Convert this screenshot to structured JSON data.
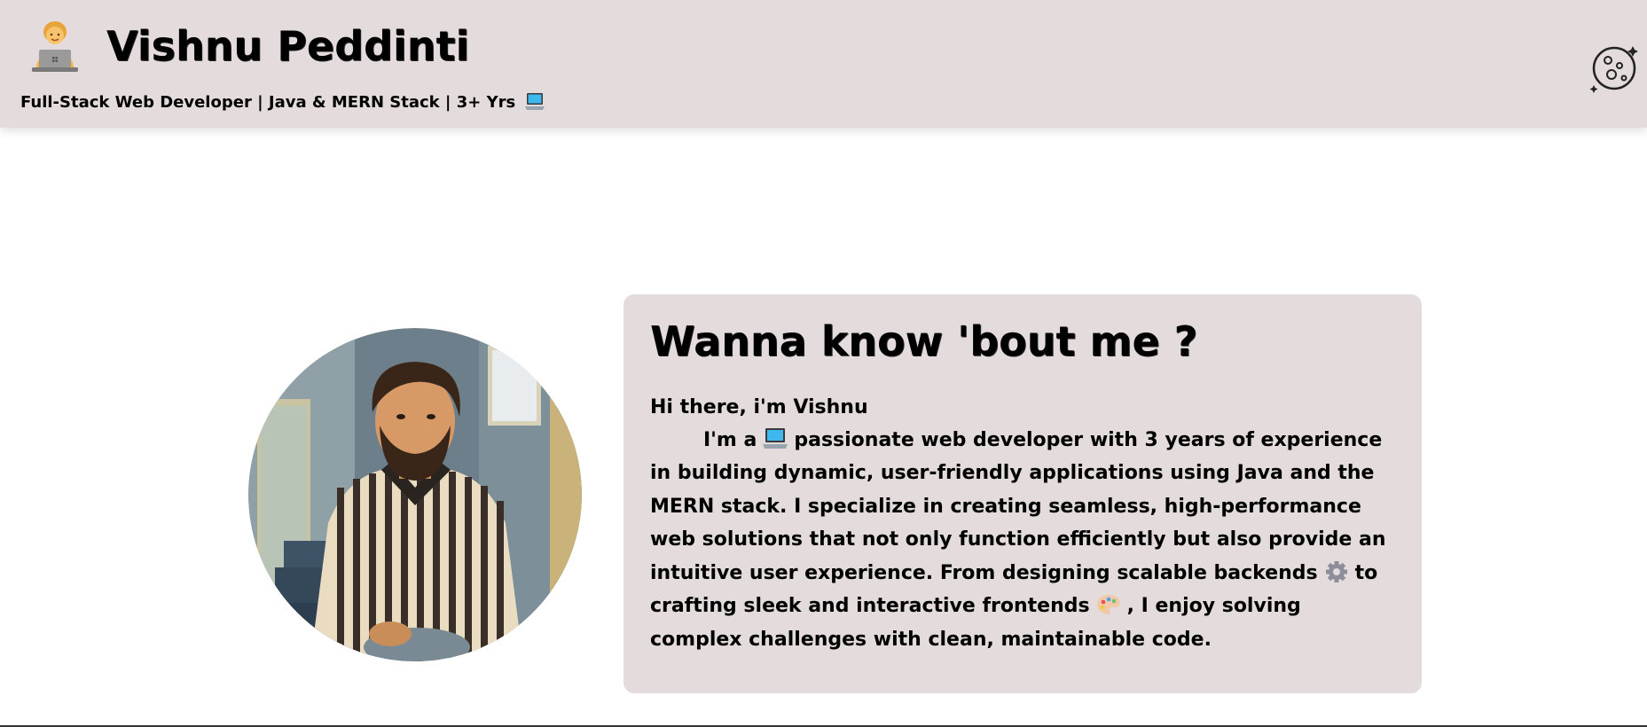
{
  "header": {
    "title": "Vishnu Peddinti",
    "tagline": "Full-Stack Web Developer | Java & MERN Stack | 3+ Yrs",
    "avatar_icon": "technologist-emoji-icon",
    "tagline_icon": "laptop-emoji-icon",
    "theme_toggle_icon": "moon-icon"
  },
  "about": {
    "title": "Wanna know 'bout me ?",
    "greeting": "Hi there, i'm Vishnu",
    "body_part1": "I'm a",
    "body_part2": "passionate web developer with 3 years of experience in building dynamic, user-friendly applications using Java and the MERN stack. I specialize in creating seamless, high-performance web solutions that not only function efficiently but also provide an intuitive user experience. From designing scalable backends",
    "body_part3": "to crafting sleek and interactive frontends",
    "body_part4": ", I enjoy solving complex challenges with clean, maintainable code.",
    "inline_icons": [
      "laptop-emoji-icon",
      "gear-emoji-icon",
      "palette-emoji-icon"
    ]
  },
  "colors": {
    "header_bg": "#e4dcdc",
    "card_bg": "#e4dcdc",
    "page_bg": "#ffffff",
    "text": "#000000"
  }
}
